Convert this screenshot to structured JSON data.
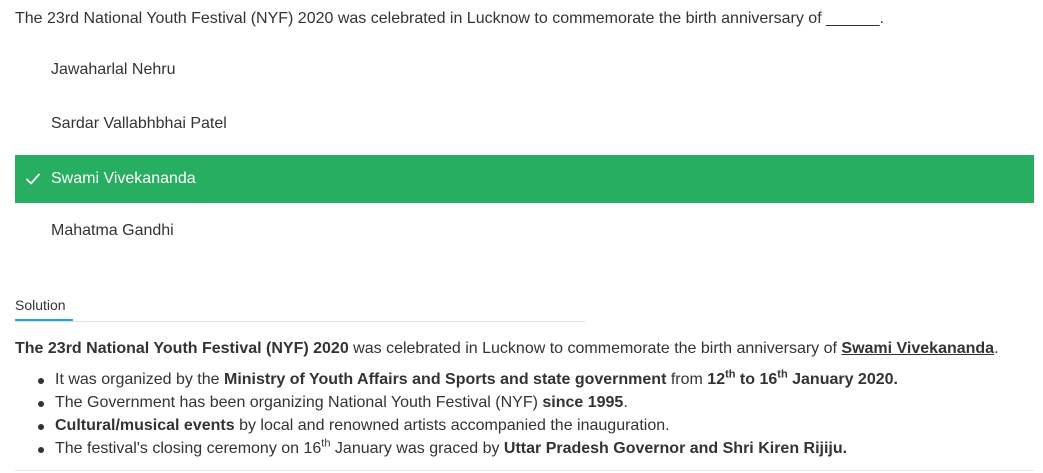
{
  "question": {
    "text": "The 23rd National Youth Festival (NYF) 2020 was celebrated in Lucknow to commemorate the birth anniversary of ______."
  },
  "options": [
    {
      "label": "Jawaharlal Nehru",
      "selected": false
    },
    {
      "label": "Sardar Vallabhbhai Patel",
      "selected": false
    },
    {
      "label": "Swami Vivekananda",
      "selected": true,
      "icon": "check-icon"
    },
    {
      "label": "Mahatma Gandhi",
      "selected": false
    }
  ],
  "solution": {
    "tab_label": "Solution",
    "para": {
      "bold": "The 23rd National Youth Festival (NYF) 2020",
      "mid": " was celebrated in Lucknow to commemorate the birth anniversary of ",
      "answer": "Swami Vivekananda",
      "end": "."
    },
    "bullets": {
      "b1": {
        "t1": "It was organized by the ",
        "b1": "Ministry of Youth Affairs and Sports and state government",
        "t2": " from ",
        "b2a": "12",
        "sup1": "th",
        "b2b": " to 16",
        "sup2": "th",
        "b2c": " January 2020."
      },
      "b2": {
        "t1": "The Government has been organizing National Youth Festival (NYF) ",
        "b1": "since 1995",
        "t2": "."
      },
      "b3": {
        "b1": "Cultural/musical events",
        "t1": " by local and renowned artists accompanied the inauguration."
      },
      "b4": {
        "t1": "The festival's closing ceremony on 16",
        "sup1": "th",
        "t2": " January was graced by ",
        "b1": "Uttar Pradesh Governor and Shri Kiren Rijiju."
      }
    }
  },
  "colors": {
    "correct_bg": "#27ae60",
    "tab_accent": "#1ba7e0",
    "text": "#333333"
  }
}
